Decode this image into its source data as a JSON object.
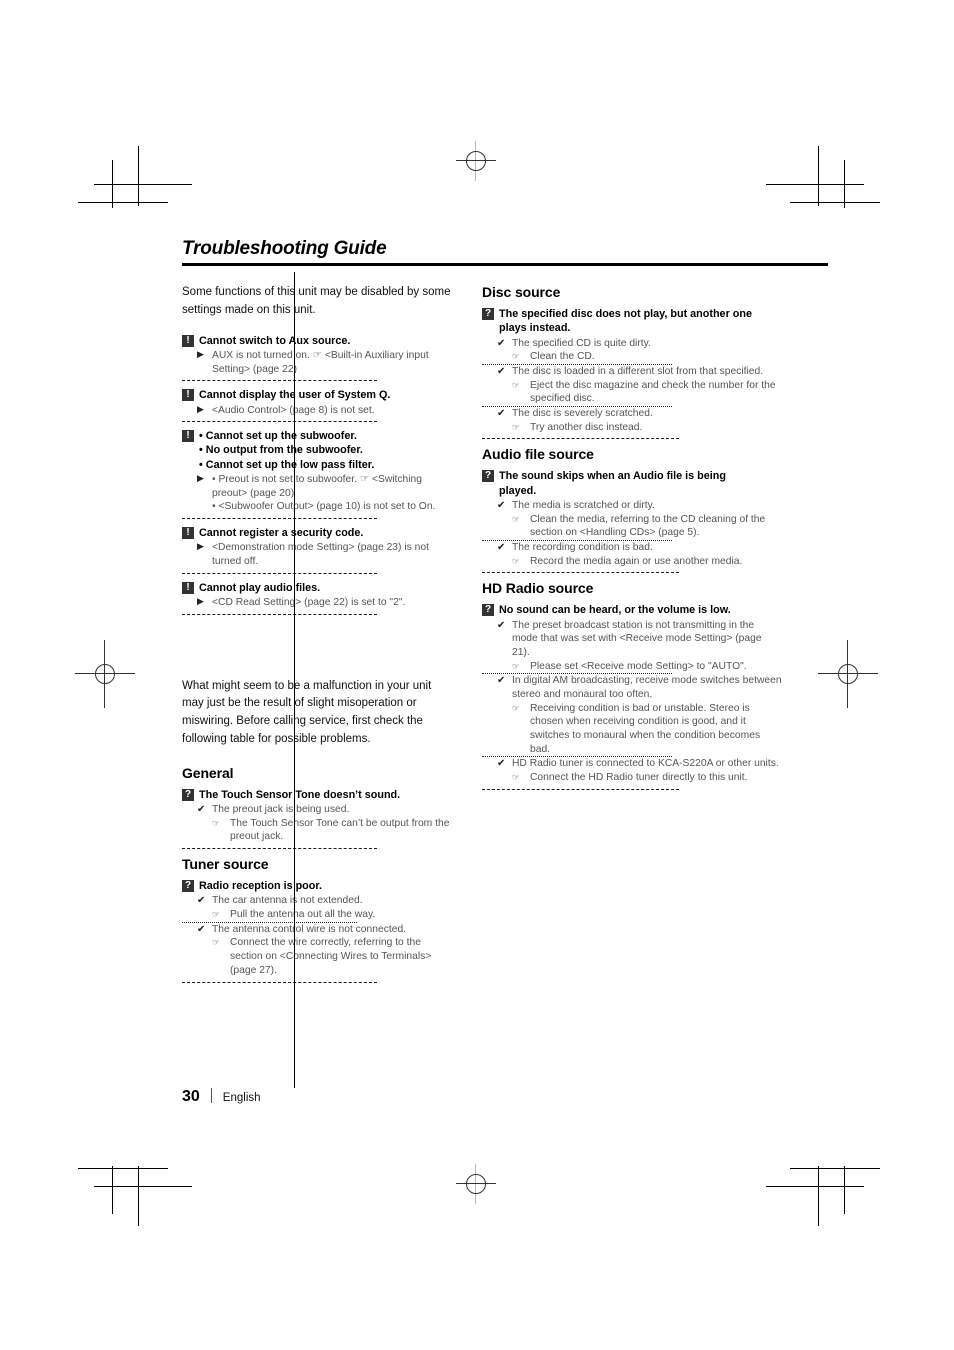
{
  "document": {
    "title": "Troubleshooting Guide",
    "footer": {
      "page_number": "30",
      "language": "English"
    },
    "icons": {
      "warning_badge": "!",
      "question_badge": "?",
      "cause_check": "✔",
      "cause_triangle": "▶",
      "remedy_hand": "☞"
    }
  },
  "left_column": {
    "intro_1": "Some functions of this unit may be disabled by some settings made on this unit.",
    "intro_2": "What might seem to be a malfunction in your unit may just be the result of slight misoperation or miswiring. Before calling service, first check the following table for possible problems.",
    "entries_top": [
      {
        "badge": "!",
        "question": "Cannot switch to Aux source.",
        "lines": [
          {
            "kind": "cause-tri",
            "text": "AUX is not turned on. ☞ <Built-in Auxiliary input Setting> (page 22)"
          }
        ]
      },
      {
        "badge": "!",
        "question": "Cannot display the user of System Q.",
        "lines": [
          {
            "kind": "cause-tri",
            "text": "<Audio Control> (page 8) is not set."
          }
        ]
      },
      {
        "badge": "!",
        "question": "• Cannot set up the subwoofer.\n• No output from the subwoofer.\n• Cannot set up the low pass filter.",
        "question_lines": [
          "• Cannot set up the subwoofer.",
          "• No output from the subwoofer.",
          "• Cannot set up the low pass filter."
        ],
        "lines": [
          {
            "kind": "cause-tri",
            "text": "• Preout is not set to subwoofer. ☞ <Switching preout> (page 20)"
          },
          {
            "kind": "sub",
            "text": "• <Subwoofer Output> (page 10) is not set to On."
          }
        ]
      },
      {
        "badge": "!",
        "question": "Cannot register a security code.",
        "lines": [
          {
            "kind": "cause-tri",
            "text": "<Demonstration mode Setting> (page 23) is not turned off."
          }
        ]
      },
      {
        "badge": "!",
        "question": "Cannot play audio files.",
        "lines": [
          {
            "kind": "cause-tri",
            "text": "<CD Read Setting> (page 22) is set to \"2\"."
          }
        ]
      }
    ],
    "sections": [
      {
        "heading": "General",
        "entries": [
          {
            "badge": "?",
            "question": "The Touch Sensor Tone doesn’t sound.",
            "lines": [
              {
                "kind": "cause",
                "text": "The preout jack is being used."
              },
              {
                "kind": "remedy",
                "text": "The Touch Sensor Tone can’t be output from the preout jack."
              }
            ]
          }
        ]
      },
      {
        "heading": "Tuner source",
        "entries": [
          {
            "badge": "?",
            "question": "Radio reception is poor.",
            "lines": [
              {
                "kind": "cause",
                "text": "The car antenna is not extended."
              },
              {
                "kind": "remedy",
                "text": "Pull the antenna out all the way."
              },
              {
                "kind": "dotted"
              },
              {
                "kind": "cause",
                "text": "The antenna control wire is not connected."
              },
              {
                "kind": "remedy",
                "text": "Connect the wire correctly, referring to the section on <Connecting Wires to Terminals> (page 27)."
              }
            ]
          }
        ]
      }
    ]
  },
  "right_column": {
    "sections": [
      {
        "heading": "Disc source",
        "entries": [
          {
            "badge": "?",
            "question_lines": [
              "The specified disc does not play, but another one",
              "plays instead."
            ],
            "lines": [
              {
                "kind": "cause",
                "text": "The specified CD is quite dirty."
              },
              {
                "kind": "remedy",
                "text": "Clean the CD."
              },
              {
                "kind": "dotted"
              },
              {
                "kind": "cause",
                "text": "The disc is loaded in a different slot from that specified."
              },
              {
                "kind": "remedy",
                "text": "Eject the disc magazine and check the number for the specified disc."
              },
              {
                "kind": "dotted"
              },
              {
                "kind": "cause",
                "text": "The disc is severely scratched."
              },
              {
                "kind": "remedy",
                "text": "Try another disc instead."
              }
            ]
          }
        ]
      },
      {
        "heading": "Audio file source",
        "entries": [
          {
            "badge": "?",
            "question_lines": [
              "The sound skips when an Audio file is being",
              "played."
            ],
            "lines": [
              {
                "kind": "cause",
                "text": "The media is scratched or dirty."
              },
              {
                "kind": "remedy",
                "text": "Clean the media, referring to the CD cleaning of the section on <Handling CDs> (page 5)."
              },
              {
                "kind": "dotted"
              },
              {
                "kind": "cause",
                "text": "The recording condition is bad."
              },
              {
                "kind": "remedy",
                "text": "Record the media again or use another media."
              }
            ]
          }
        ]
      },
      {
        "heading": "HD Radio source",
        "entries": [
          {
            "badge": "?",
            "question_lines": [
              "No sound can be heard, or the volume is low."
            ],
            "lines": [
              {
                "kind": "cause",
                "text": "The preset broadcast station is not transmitting in the mode that was set with <Receive mode Setting> (page 21)."
              },
              {
                "kind": "remedy",
                "text": "Please set <Receive mode Setting> to \"AUTO\"."
              },
              {
                "kind": "dotted"
              },
              {
                "kind": "cause",
                "text": "In digital AM broadcasting, receive mode switches between stereo and monaural too often."
              },
              {
                "kind": "remedy",
                "text": "Receiving condition is bad or unstable. Stereo is chosen when receiving condition is good, and it switches to monaural when the condition becomes bad."
              },
              {
                "kind": "dotted"
              },
              {
                "kind": "cause",
                "text": "HD Radio tuner is connected to KCA-S220A or other units."
              },
              {
                "kind": "remedy",
                "text": "Connect the HD Radio tuner directly to this unit."
              }
            ]
          }
        ]
      }
    ]
  }
}
